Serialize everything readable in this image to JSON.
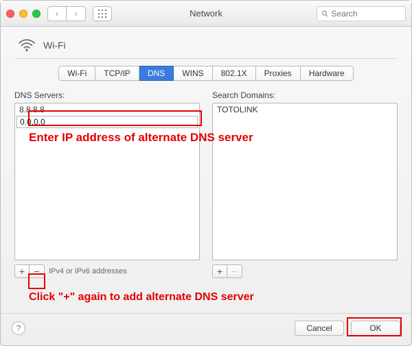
{
  "window": {
    "title": "Network"
  },
  "search": {
    "placeholder": "Search"
  },
  "wifi": {
    "label": "Wi-Fi"
  },
  "tabs": [
    {
      "label": "Wi-Fi"
    },
    {
      "label": "TCP/IP"
    },
    {
      "label": "DNS"
    },
    {
      "label": "WINS"
    },
    {
      "label": "802.1X"
    },
    {
      "label": "Proxies"
    },
    {
      "label": "Hardware"
    }
  ],
  "dns": {
    "title": "DNS Servers:",
    "items": [
      "8.8.8.8"
    ],
    "editing": "0.0.0.0",
    "hint": "IPv4 or IPv6 addresses",
    "add": "+",
    "remove": "−"
  },
  "domains": {
    "title": "Search Domains:",
    "items": [
      "TOTOLINK"
    ],
    "add": "+",
    "remove": "−"
  },
  "footer": {
    "help": "?",
    "cancel": "Cancel",
    "ok": "OK"
  },
  "annotations": {
    "line1": "Enter IP address of alternate DNS server",
    "line2": "Click \"+\" again to add alternate DNS server"
  }
}
